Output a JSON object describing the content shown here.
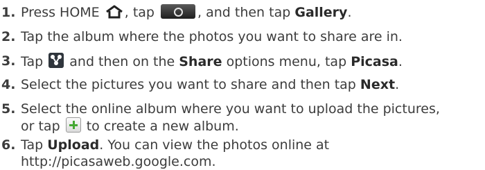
{
  "steps": [
    {
      "num": "1.",
      "t1": "Press HOME",
      "t2": ", tap",
      "t3": ", and then tap",
      "em1": "Gallery",
      "t4": "."
    },
    {
      "num": "2.",
      "t1": "Tap the album where the photos you want to share are in."
    },
    {
      "num": "3.",
      "t1": "Tap",
      "t2": "and then on the",
      "em1": "Share",
      "t3": "options menu, tap",
      "em2": "Picasa",
      "t4": "."
    },
    {
      "num": "4.",
      "t1": "Select the pictures you want to share and then tap",
      "em1": "Next",
      "t2": "."
    },
    {
      "num": "5.",
      "t1": "Select the online album where you want to upload the pictures,",
      "l2a": "or tap",
      "l2b": "to create a new album."
    },
    {
      "num": "6.",
      "t1": "Tap",
      "em1": "Upload",
      "t2": ". You can view the photos online at",
      "l2": "http://picasaweb.google.com."
    }
  ],
  "icons": {
    "home": "home-icon",
    "camera": "camera-icon",
    "share": "share-icon",
    "add": "plus-icon"
  },
  "colors": {
    "text": "#3c3c3c",
    "plus_green": "#44a832"
  }
}
